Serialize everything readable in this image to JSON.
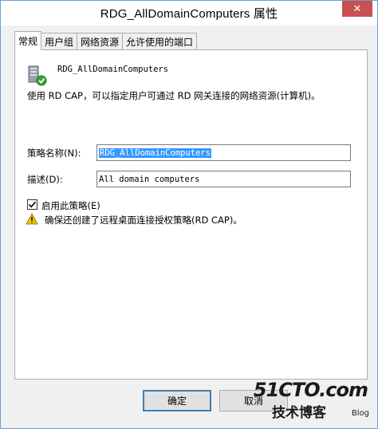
{
  "window": {
    "title": "RDG_AllDomainComputers 属性",
    "close_glyph": "✕"
  },
  "tabs": [
    {
      "label": "常规",
      "active": true
    },
    {
      "label": "用户组",
      "active": false
    },
    {
      "label": "网络资源",
      "active": false
    },
    {
      "label": "允许使用的端口",
      "active": false
    }
  ],
  "general": {
    "policy_heading": "RDG_AllDomainComputers",
    "description": "使用 RD CAP，可以指定用户可通过 RD 网关连接的网络资源(计算机)。",
    "name_label": "策略名称(N):",
    "name_value": "RDG_AllDomainComputers",
    "desc_label": "描述(D):",
    "desc_value": "All domain computers",
    "enable_label": "启用此策略(E)",
    "enable_checked": true,
    "warning_text": "确保还创建了远程桌面连接授权策略(RD CAP)。"
  },
  "buttons": {
    "ok": "确定",
    "cancel": "取消"
  },
  "watermark": {
    "site": "51CTO.com",
    "line2": "技术博客",
    "line3": "Blog"
  },
  "colors": {
    "accent": "#3399ff",
    "close_bg": "#c75050",
    "warning": "#f2c500"
  }
}
